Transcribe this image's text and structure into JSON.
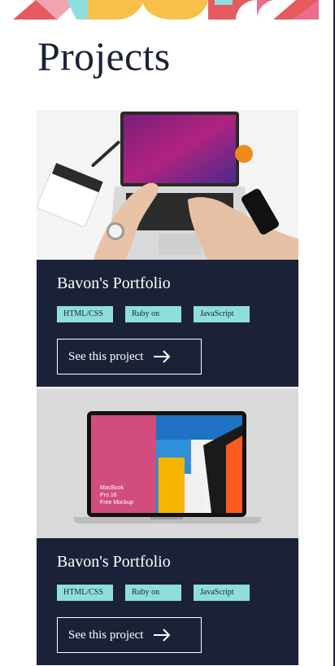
{
  "page": {
    "title": "Projects"
  },
  "projects": [
    {
      "title": "Bavon's Portfolio",
      "tags": [
        "HTML/CSS",
        "Ruby on Rails",
        "JavaScript"
      ],
      "button_label": "See this project",
      "image_subject": "laptop-on-desk-photo"
    },
    {
      "title": "Bavon's Portfolio",
      "tags": [
        "HTML/CSS",
        "Ruby on Rails",
        "JavaScript"
      ],
      "button_label": "See this project",
      "image_subject": "macbook-mockup",
      "image_text": [
        "MacBook",
        "Pro 16",
        "Free Mockup"
      ]
    }
  ],
  "colors": {
    "navy": "#1b2238",
    "tag_teal": "#8fdede",
    "accent_red": "#e65b5f",
    "accent_yellow": "#f7c04a",
    "accent_pink": "#ec6c8c"
  },
  "icons": {
    "button_icon": "arrow-right-icon"
  }
}
